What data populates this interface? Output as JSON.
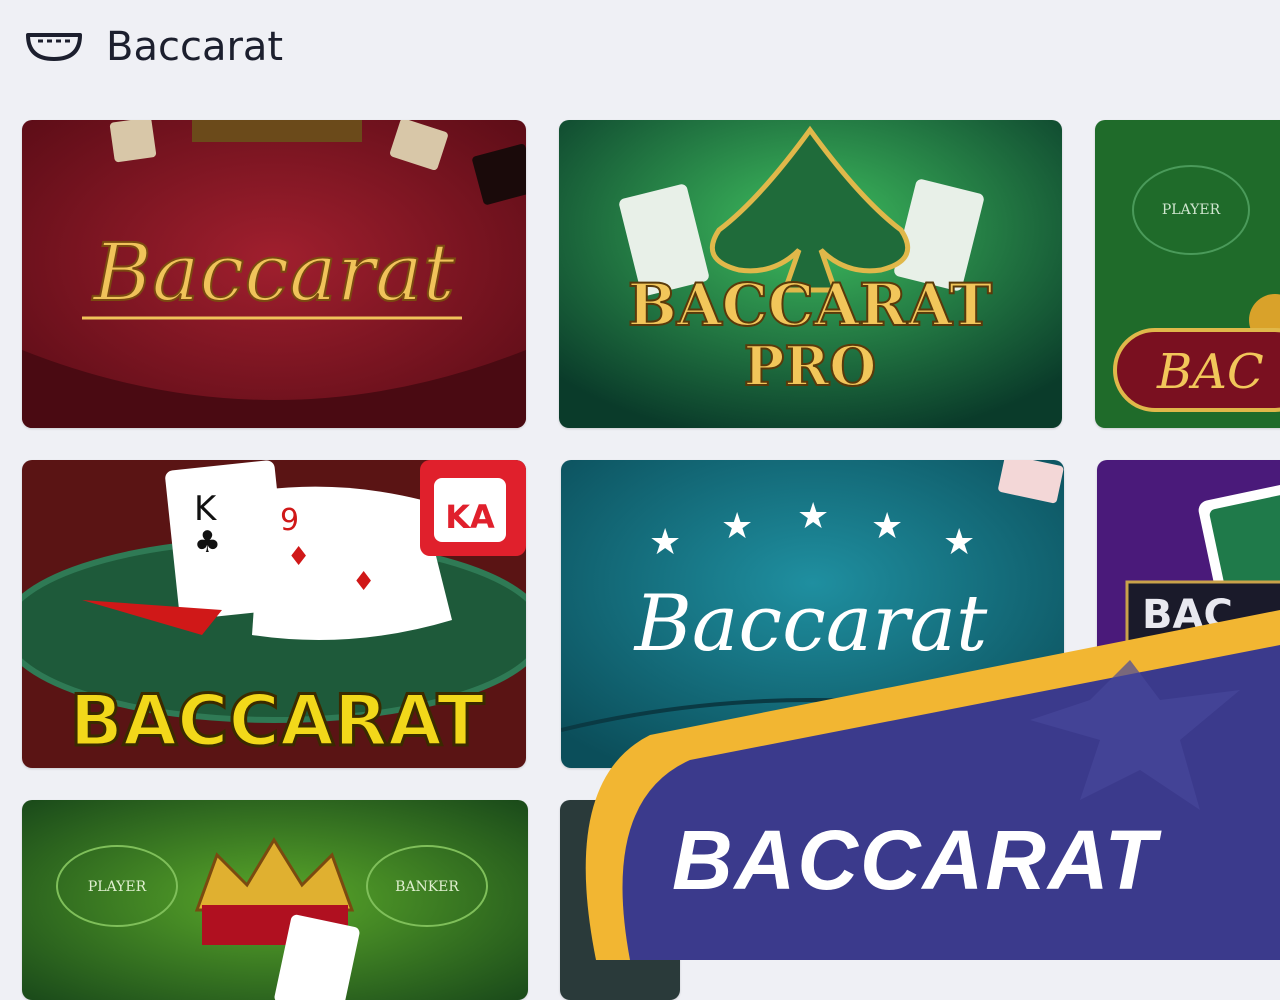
{
  "header": {
    "icon": "baccarat-table-icon",
    "title": "Baccarat"
  },
  "colors": {
    "page_bg": "#eff0f5",
    "banner_purple": "#3b3a8c",
    "banner_gold": "#f2b632"
  },
  "games": [
    {
      "logo_text": "Baccarat",
      "theme": "red-table"
    },
    {
      "logo_text_line1": "BACCARAT",
      "logo_text_line2": "PRO",
      "theme": "green-spade"
    },
    {
      "table_label": "PLAYER",
      "logo_text": "BAC",
      "theme": "green-coins"
    },
    {
      "card1_rank": "K",
      "card2_rank": "9",
      "provider_badge": "KA",
      "logo_text": "BACCARAT",
      "theme": "yellow-cards"
    },
    {
      "logo_text": "Baccarat",
      "theme": "teal-stars"
    },
    {
      "logo_text": "BAC",
      "theme": "purple-cards"
    },
    {
      "table_label_left": "PLAYER",
      "table_label_right": "BANKER",
      "theme": "green-crown"
    },
    {
      "theme": "partial"
    }
  ],
  "banner": {
    "label": "BACCARAT"
  }
}
